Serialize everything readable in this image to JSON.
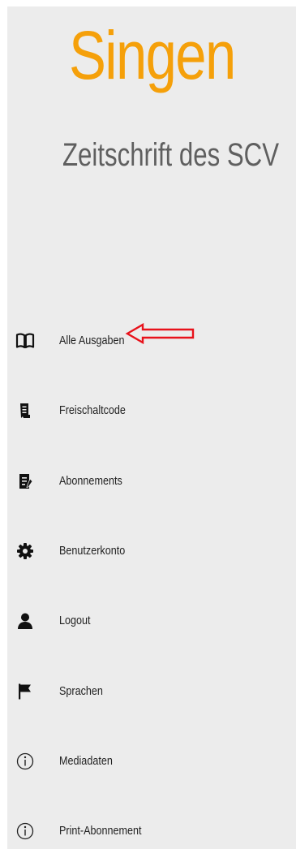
{
  "brand": {
    "title": "Singen",
    "subtitle": "Zeitschrift des SCV",
    "title_color": "#f5a00a",
    "subtitle_color": "#5f5f5f"
  },
  "menu": {
    "items": [
      {
        "label": "Alle Ausgaben",
        "icon": "book-open-icon"
      },
      {
        "label": "Freischaltcode",
        "icon": "document-code-icon"
      },
      {
        "label": "Abonnements",
        "icon": "document-edit-icon"
      },
      {
        "label": "Benutzerkonto",
        "icon": "gear-icon"
      },
      {
        "label": "Logout",
        "icon": "user-icon"
      },
      {
        "label": "Sprachen",
        "icon": "flag-icon"
      },
      {
        "label": "Mediadaten",
        "icon": "info-circle-icon"
      },
      {
        "label": "Print-Abonnement",
        "icon": "info-circle-icon"
      }
    ]
  },
  "annotation": {
    "arrow_color": "#e8121b",
    "target": "Alle Ausgaben",
    "icon": "left-arrow-icon"
  }
}
